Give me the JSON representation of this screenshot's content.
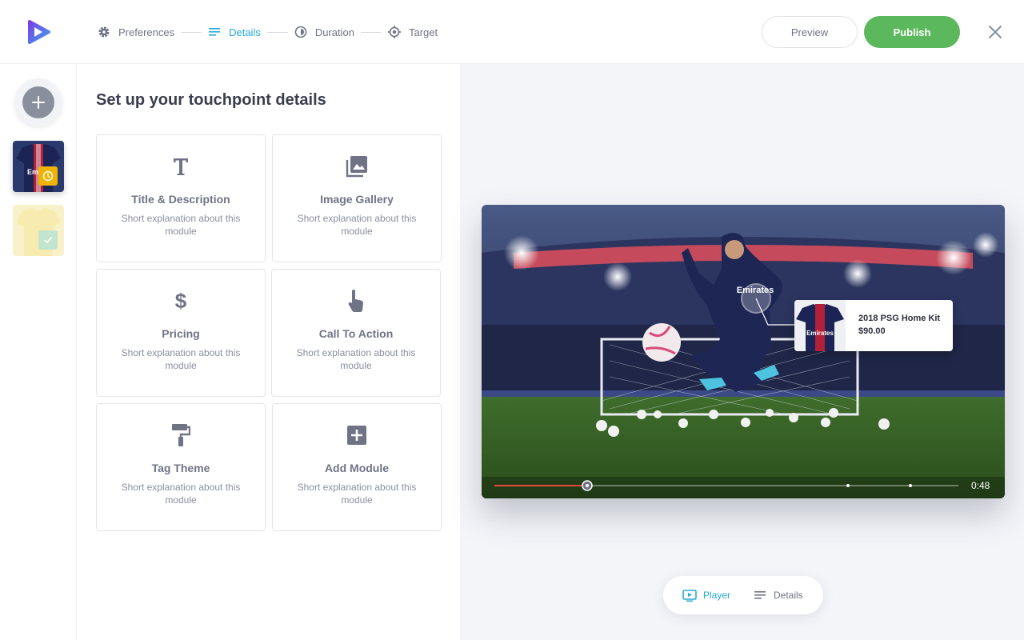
{
  "header": {
    "steps": [
      {
        "label": "Preferences",
        "icon": "gear-icon"
      },
      {
        "label": "Details",
        "icon": "details-lines-icon"
      },
      {
        "label": "Duration",
        "icon": "duration-clock-icon"
      },
      {
        "label": "Target",
        "icon": "target-icon"
      }
    ],
    "active_step": "Details",
    "preview_label": "Preview",
    "publish_label": "Publish"
  },
  "panel": {
    "title": "Set up your touchpoint details",
    "modules": [
      {
        "title": "Title & Description",
        "desc": "Short explanation about this module",
        "icon": "text-t-icon"
      },
      {
        "title": "Image Gallery",
        "desc": "Short explanation about this module",
        "icon": "image-gallery-icon"
      },
      {
        "title": "Pricing",
        "desc": "Short explanation about this module",
        "icon": "dollar-icon"
      },
      {
        "title": "Call To Action",
        "desc": "Short explanation about this module",
        "icon": "pointer-hand-icon"
      },
      {
        "title": "Tag Theme",
        "desc": "Short explanation about this module",
        "icon": "paint-roller-icon"
      },
      {
        "title": "Add Module",
        "desc": "Short explanation about this module",
        "icon": "plus-square-icon"
      }
    ]
  },
  "preview": {
    "product_name": "2018 PSG Home Kit",
    "product_price": "$90.00",
    "time": "0:48",
    "progress": 0.2
  },
  "view_toggle": {
    "player_label": "Player",
    "details_label": "Details"
  },
  "colors": {
    "accent": "#28a8d6",
    "publish": "#5cb85c",
    "progress": "#e84a3c",
    "clock_badge": "#f0b400",
    "check_badge": "#8fd0a8"
  }
}
